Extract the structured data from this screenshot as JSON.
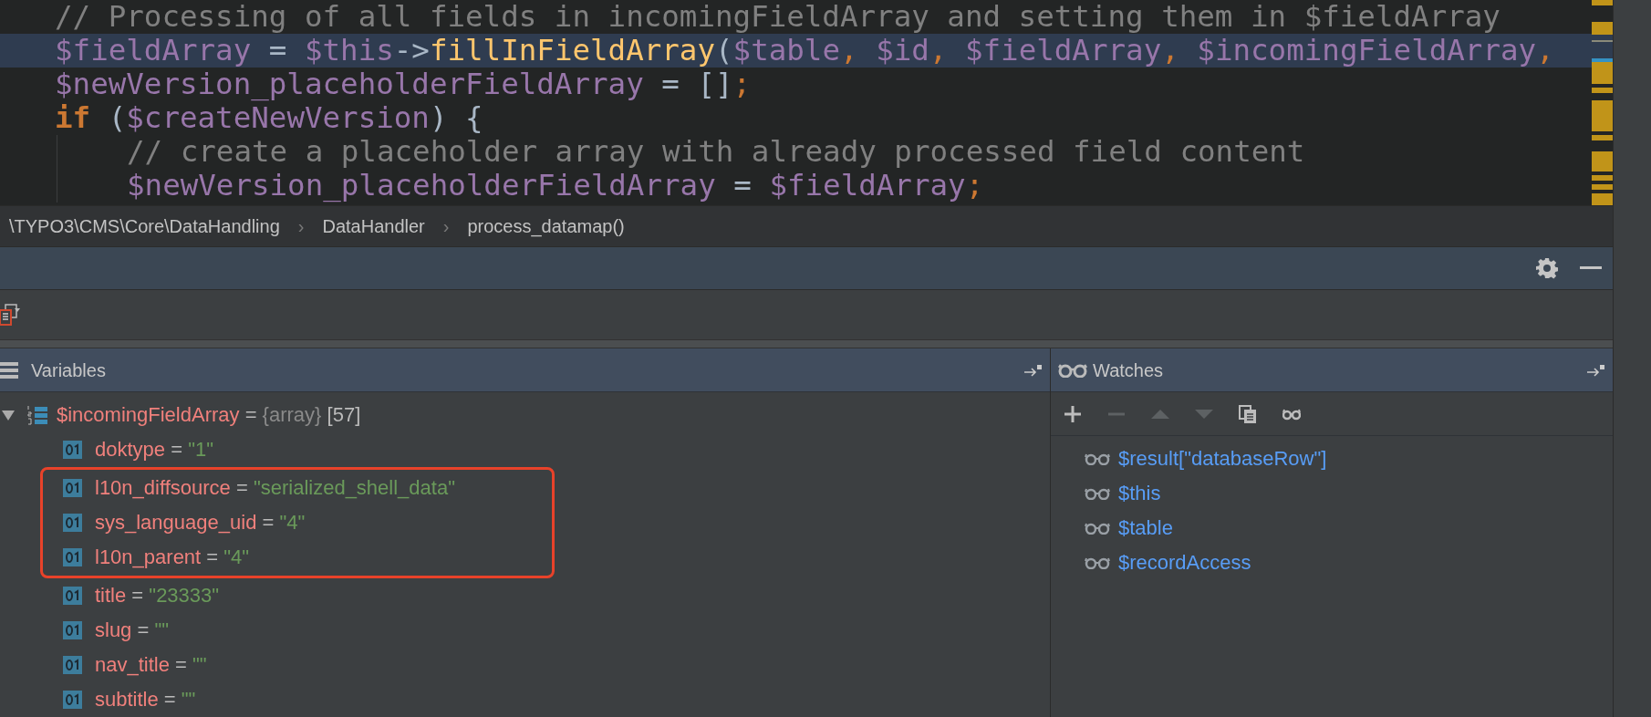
{
  "editor": {
    "lines": [
      {
        "current": false,
        "guide": false,
        "tokens": [
          {
            "kind": "comment",
            "text": "// Processing of all fields in incomingFieldArray and setting them in $fieldArray"
          }
        ]
      },
      {
        "current": true,
        "guide": false,
        "tokens": [
          {
            "kind": "variable",
            "text": "$fieldArray"
          },
          {
            "kind": "plain",
            "text": " = "
          },
          {
            "kind": "variable",
            "text": "$this"
          },
          {
            "kind": "plain",
            "text": "->"
          },
          {
            "kind": "function",
            "text": "fillInFieldArray"
          },
          {
            "kind": "plain",
            "text": "("
          },
          {
            "kind": "variable",
            "text": "$table"
          },
          {
            "kind": "punct",
            "text": ", "
          },
          {
            "kind": "variable",
            "text": "$id"
          },
          {
            "kind": "punct",
            "text": ", "
          },
          {
            "kind": "variable",
            "text": "$fieldArray"
          },
          {
            "kind": "punct",
            "text": ", "
          },
          {
            "kind": "variable",
            "text": "$incomingFieldArray"
          },
          {
            "kind": "punct",
            "text": ","
          }
        ]
      },
      {
        "current": false,
        "guide": false,
        "tokens": [
          {
            "kind": "variable",
            "text": "$newVersion_placeholderFieldArray"
          },
          {
            "kind": "plain",
            "text": " = []"
          },
          {
            "kind": "punct",
            "text": ";"
          }
        ]
      },
      {
        "current": false,
        "guide": false,
        "tokens": [
          {
            "kind": "keyword",
            "text": "if"
          },
          {
            "kind": "plain",
            "text": " ("
          },
          {
            "kind": "variable",
            "text": "$createNewVersion"
          },
          {
            "kind": "plain",
            "text": ") {"
          }
        ]
      },
      {
        "current": false,
        "guide": true,
        "tokens": [
          {
            "kind": "comment",
            "text": "// create a placeholder array with already processed field content"
          }
        ]
      },
      {
        "current": false,
        "guide": true,
        "tokens": [
          {
            "kind": "variable",
            "text": "$newVersion_placeholderFieldArray"
          },
          {
            "kind": "plain",
            "text": " = "
          },
          {
            "kind": "variable",
            "text": "$fieldArray"
          },
          {
            "kind": "punct",
            "text": ";"
          }
        ]
      }
    ]
  },
  "breadcrumbs": [
    {
      "kind": "segment",
      "text": "\\TYPO3\\CMS\\Core\\DataHandling"
    },
    {
      "kind": "separator",
      "text": "›"
    },
    {
      "kind": "segment",
      "text": "DataHandler"
    },
    {
      "kind": "separator",
      "text": "›"
    },
    {
      "kind": "segment",
      "text": "process_datamap()"
    }
  ],
  "variables": {
    "title": "Variables",
    "tree": [
      {
        "name": "$incomingFieldArray",
        "op": "=",
        "type": "{array}",
        "count": "[57]",
        "expanded": true,
        "children": [
          {
            "name": "doktype",
            "op": "=",
            "value": "\"1\"",
            "highlighted": false
          },
          {
            "name": "l10n_diffsource",
            "op": "=",
            "value": "\"serialized_shell_data\"",
            "highlighted": true
          },
          {
            "name": "sys_language_uid",
            "op": "=",
            "value": "\"4\"",
            "highlighted": true
          },
          {
            "name": "l10n_parent",
            "op": "=",
            "value": "\"4\"",
            "highlighted": true
          },
          {
            "name": "title",
            "op": "=",
            "value": "\"23333\"",
            "highlighted": false
          },
          {
            "name": "slug",
            "op": "=",
            "value": "\"\"",
            "highlighted": false
          },
          {
            "name": "nav_title",
            "op": "=",
            "value": "\"\"",
            "highlighted": false
          },
          {
            "name": "subtitle",
            "op": "=",
            "value": "\"\"",
            "highlighted": false
          }
        ]
      }
    ]
  },
  "watches": {
    "title": "Watches",
    "toolbar": [
      {
        "kind": "add",
        "disabled": false
      },
      {
        "kind": "remove",
        "disabled": true
      },
      {
        "kind": "up",
        "disabled": true
      },
      {
        "kind": "down",
        "disabled": true
      },
      {
        "kind": "copy",
        "disabled": false
      },
      {
        "kind": "watch",
        "disabled": false
      }
    ],
    "items": [
      {
        "text": "$result[\"databaseRow\"]"
      },
      {
        "text": "$this"
      },
      {
        "text": "$table"
      },
      {
        "text": "$recordAccess"
      }
    ]
  }
}
